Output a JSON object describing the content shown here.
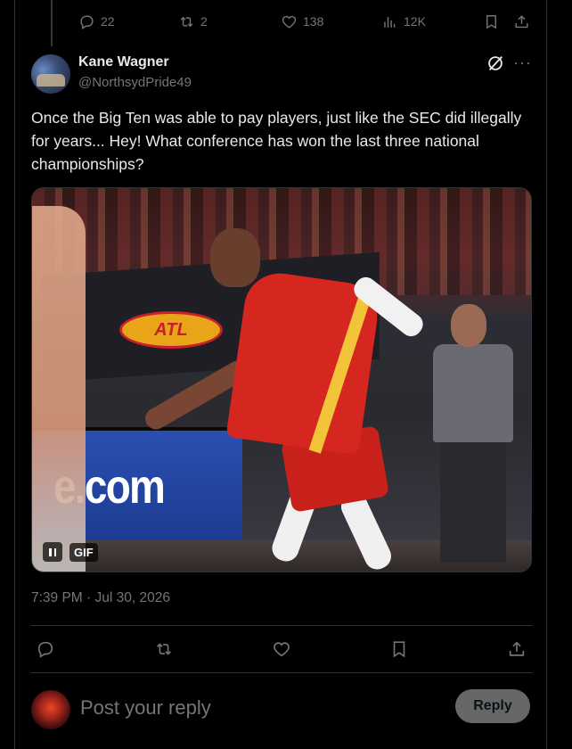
{
  "previous_post": {
    "actions": {
      "replies": "22",
      "reposts": "2",
      "likes": "138",
      "views": "12K"
    }
  },
  "post": {
    "author_name": "Kane Wagner",
    "author_handle": "@NorthsydPride49",
    "text": "Once the Big Ten was able to pay players, just like the SEC did illegally for years... Hey! What conference has won the last three national championships?",
    "media": {
      "gif_label": "GIF",
      "arena_sign": "ATL",
      "ad_board_text": "e.com"
    },
    "timestamp": "7:39 PM · Jul 30, 2026"
  },
  "reply_box": {
    "placeholder": "Post your reply",
    "button_label": "Reply"
  },
  "colors": {
    "background": "#000000",
    "text_primary": "#e7e9ea",
    "text_secondary": "#71767b",
    "border": "#2f3336",
    "reply_button": "#787a7a"
  }
}
